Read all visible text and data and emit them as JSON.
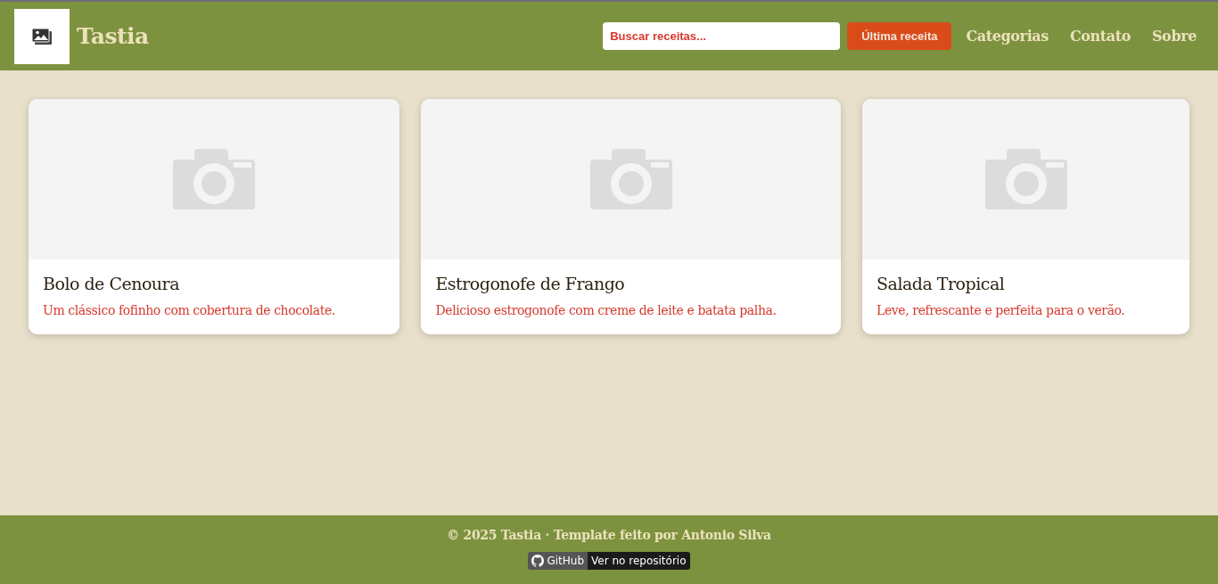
{
  "header": {
    "brand": "Tastia",
    "search": {
      "placeholder": "Buscar receitas..."
    },
    "button": "Última receita",
    "nav": [
      "Categorias",
      "Contato",
      "Sobre"
    ]
  },
  "cards": [
    {
      "title": "Bolo de Cenoura",
      "description": "Um clássico fofinho com cobertura de chocolate."
    },
    {
      "title": "Estrogonofe de Frango",
      "description": "Delicioso estrogonofe com creme de leite e batata palha."
    },
    {
      "title": "Salada Tropical",
      "description": "Leve, refrescante e perfeita para o verão."
    }
  ],
  "footer": {
    "text": "© 2025 Tastia · Template feito por Antonio Silva",
    "badge": {
      "label": "GitHub",
      "message": "Ver no repositório"
    }
  }
}
